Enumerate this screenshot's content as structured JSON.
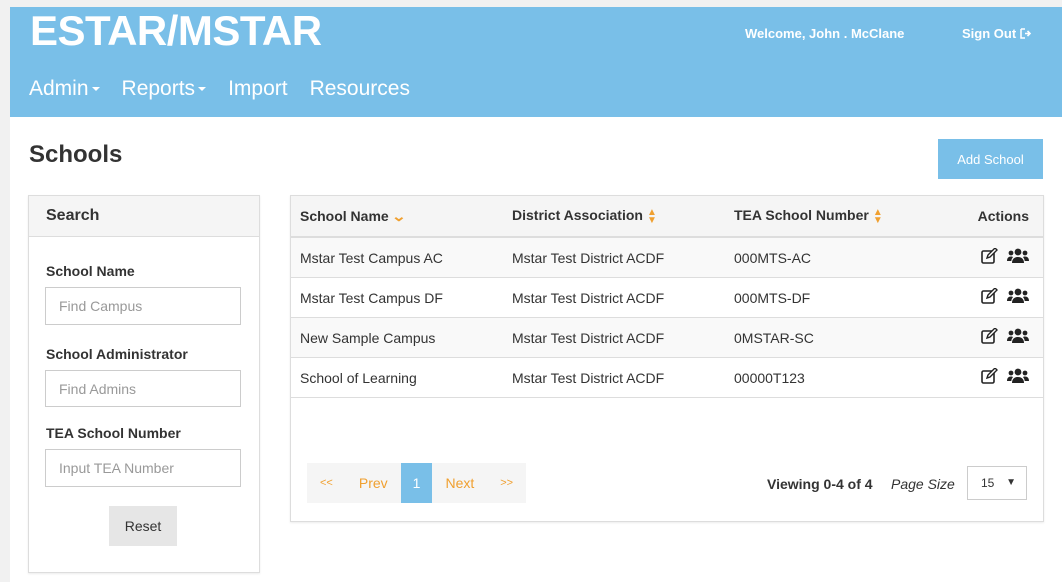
{
  "header": {
    "brand": "ESTAR/MSTAR",
    "welcome": "Welcome, John . McClane",
    "sign_out": "Sign Out",
    "nav": {
      "admin": "Admin",
      "reports": "Reports",
      "import": "Import",
      "resources": "Resources"
    }
  },
  "page": {
    "title": "Schools",
    "add_button": "Add School"
  },
  "search": {
    "title": "Search",
    "school_name_label": "School Name",
    "school_name_placeholder": "Find Campus",
    "admin_label": "School Administrator",
    "admin_placeholder": "Find Admins",
    "tea_label": "TEA School Number",
    "tea_placeholder": "Input TEA Number",
    "reset": "Reset"
  },
  "table": {
    "columns": [
      "School Name",
      "District Association",
      "TEA School Number",
      "Actions"
    ],
    "rows": [
      {
        "school": "Mstar Test Campus AC",
        "district": "Mstar Test District ACDF",
        "tea": "000MTS-AC"
      },
      {
        "school": "Mstar Test Campus DF",
        "district": "Mstar Test District ACDF",
        "tea": "000MTS-DF"
      },
      {
        "school": "New Sample Campus",
        "district": "Mstar Test District ACDF",
        "tea": "0MSTAR-SC"
      },
      {
        "school": "School of Learning",
        "district": "Mstar Test District ACDF",
        "tea": "00000T123"
      }
    ]
  },
  "pagination": {
    "first": "<<",
    "prev": "Prev",
    "current": "1",
    "next": "Next",
    "last": ">>",
    "viewing": "Viewing 0-4 of 4",
    "page_size_label": "Page Size",
    "page_size": "15"
  },
  "icons": {
    "sign_out": "sign-out-icon",
    "edit": "edit-icon",
    "users": "users-icon",
    "sort_desc": "chevron-down-icon",
    "sort": "sort-icon"
  },
  "colors": {
    "header": "#79bfe8",
    "accent": "#f0a030"
  }
}
